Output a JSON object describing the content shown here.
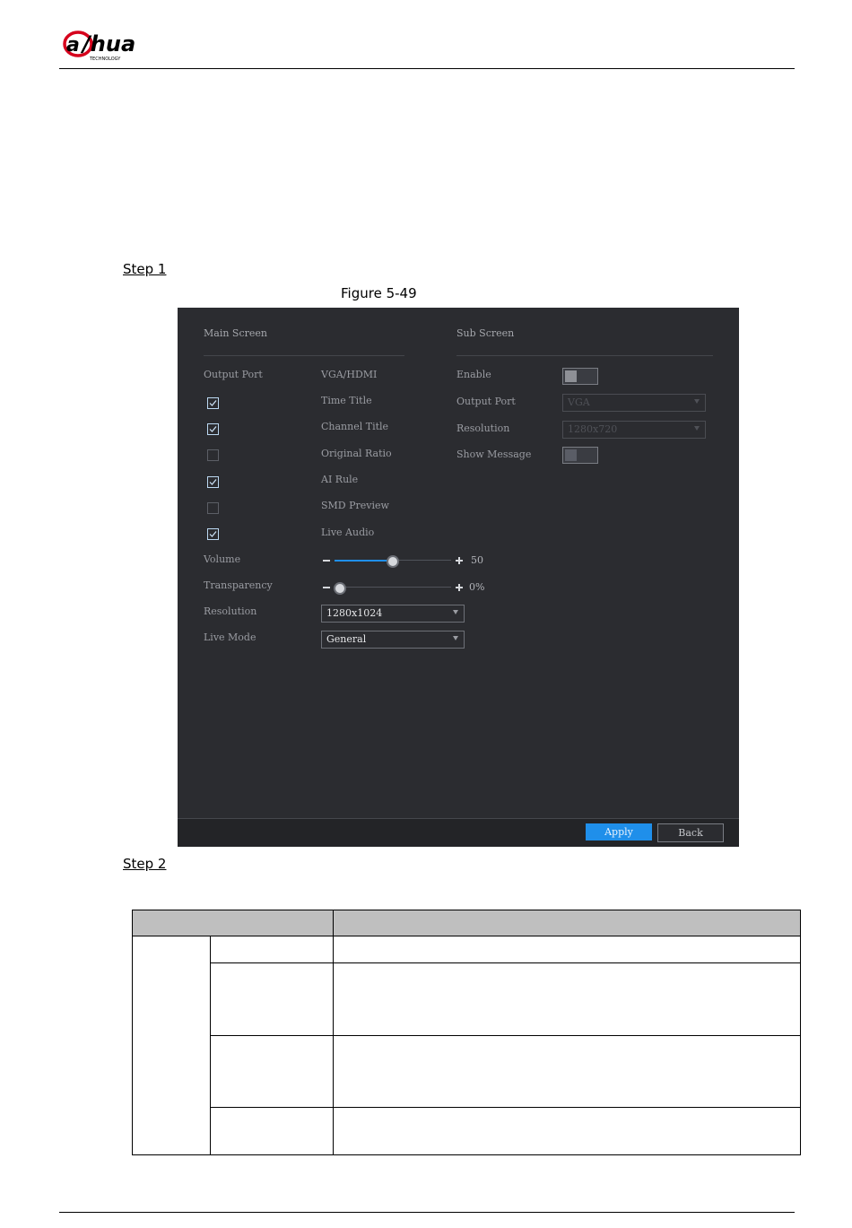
{
  "header": {
    "brand": "alhua",
    "brand_sub": "TECHNOLOGY"
  },
  "steps": {
    "step1": "Step 1",
    "step2": "Step 2"
  },
  "figure": {
    "caption": "Figure 5-49"
  },
  "ui": {
    "main_screen": {
      "title": "Main Screen",
      "output_port_label": "Output Port",
      "output_port_value": "VGA/HDMI",
      "options": [
        {
          "label": "Time Title",
          "checked": true
        },
        {
          "label": "Channel Title",
          "checked": true
        },
        {
          "label": "Original Ratio",
          "checked": false
        },
        {
          "label": "AI Rule",
          "checked": true
        },
        {
          "label": "SMD Preview",
          "checked": false
        },
        {
          "label": "Live Audio",
          "checked": true
        }
      ],
      "volume": {
        "label": "Volume",
        "value": "50",
        "level": 0.5
      },
      "transparency": {
        "label": "Transparency",
        "value": "0%",
        "level": 0.0
      },
      "resolution": {
        "label": "Resolution",
        "value": "1280x1024"
      },
      "live_mode": {
        "label": "Live Mode",
        "value": "General"
      }
    },
    "sub_screen": {
      "title": "Sub Screen",
      "enable_label": "Enable",
      "output_port_label": "Output Port",
      "output_port_value": "VGA",
      "resolution_label": "Resolution",
      "resolution_value": "1280x720",
      "show_message_label": "Show Message"
    },
    "buttons": {
      "apply": "Apply",
      "back": "Back"
    }
  },
  "colors": {
    "panel_bg": "#2b2c30",
    "accent": "#1f8fea",
    "table_header": "#bfbfbf"
  }
}
